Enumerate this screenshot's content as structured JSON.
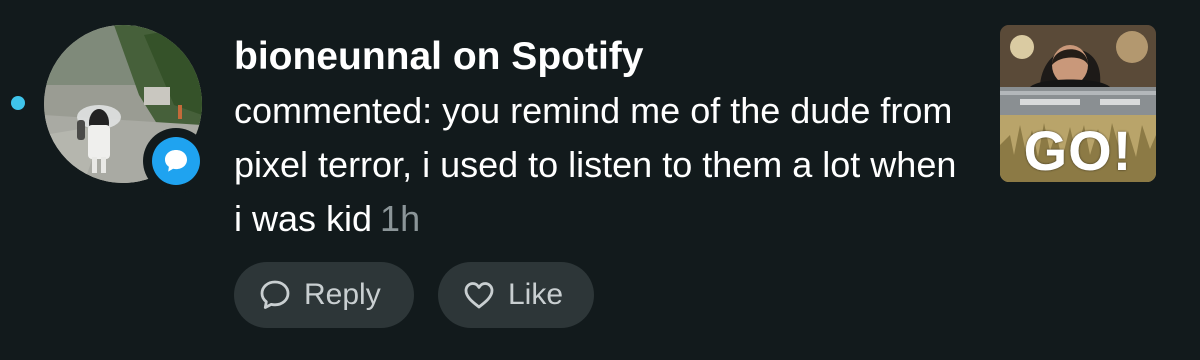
{
  "notification": {
    "unread": true,
    "accent_color": "#3fc4ea",
    "badge_icon": "comment-bubble-icon",
    "badge_color": "#1fa3f0",
    "title": "bioneunnal on Spotify",
    "comment": "commented: you remind me of the dude from pixel terror, i used to listen to them a lot when i was kid",
    "time": "1h",
    "thumbnail": {
      "overlay_text": "GO!"
    },
    "actions": {
      "reply_icon": "speech-bubble-icon",
      "reply_label": "Reply",
      "like_icon": "heart-icon",
      "like_label": "Like"
    }
  }
}
